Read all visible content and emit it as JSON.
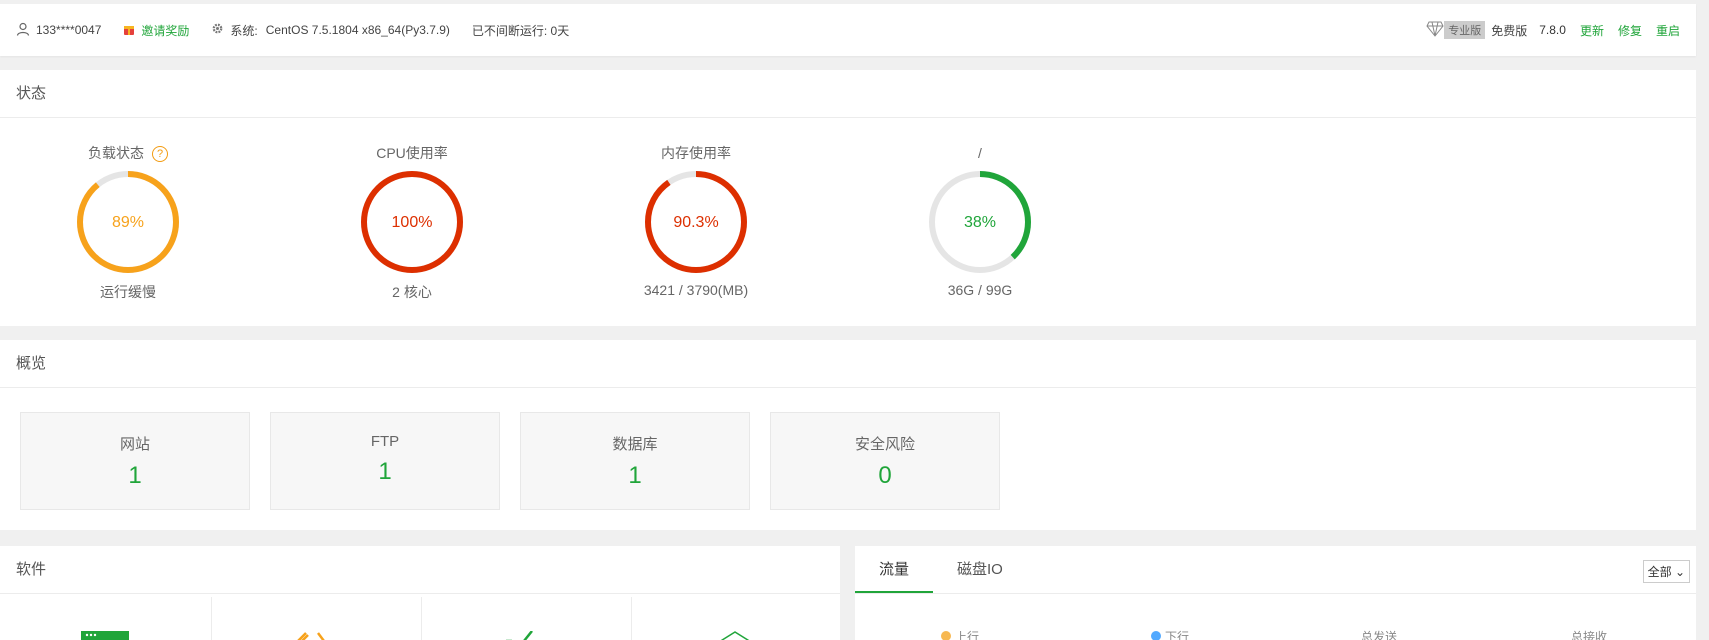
{
  "topbar": {
    "user": "133****0047",
    "invite": "邀请奖励",
    "system_label": "系统:",
    "system_value": "CentOS 7.5.1804 x86_64(Py3.7.9)",
    "uptime": "已不间断运行: 0天",
    "edition_badge": "专业版",
    "free_edition": "免费版",
    "version": "7.8.0",
    "update": "更新",
    "repair": "修复",
    "restart": "重启"
  },
  "status": {
    "title": "状态",
    "gauges": [
      {
        "label": "负载状态",
        "value": "89%",
        "sub": "运行缓慢",
        "percent": 89,
        "color": "#f7a21b"
      },
      {
        "label": "CPU使用率",
        "value": "100%",
        "sub": "2 核心",
        "percent": 100,
        "color": "#dd2f00"
      },
      {
        "label": "内存使用率",
        "value": "90.3%",
        "sub": "3421 / 3790(MB)",
        "percent": 90.3,
        "color": "#dd2f00"
      },
      {
        "label": "/",
        "value": "38%",
        "sub": "36G / 99G",
        "percent": 38,
        "color": "#20a53a"
      }
    ],
    "help_glyph": "?"
  },
  "overview": {
    "title": "概览",
    "cards": [
      {
        "title": "网站",
        "count": "1"
      },
      {
        "title": "FTP",
        "count": "1"
      },
      {
        "title": "数据库",
        "count": "1"
      },
      {
        "title": "安全风险",
        "count": "0"
      }
    ]
  },
  "software": {
    "title": "软件"
  },
  "traffic": {
    "tabs": [
      "流量",
      "磁盘IO"
    ],
    "range_select": "全部",
    "legend": [
      "上行",
      "下行",
      "总发送",
      "总接收"
    ]
  },
  "colors": {
    "accent": "#20a53a",
    "warning": "#f7a21b",
    "danger": "#dd2f00"
  }
}
